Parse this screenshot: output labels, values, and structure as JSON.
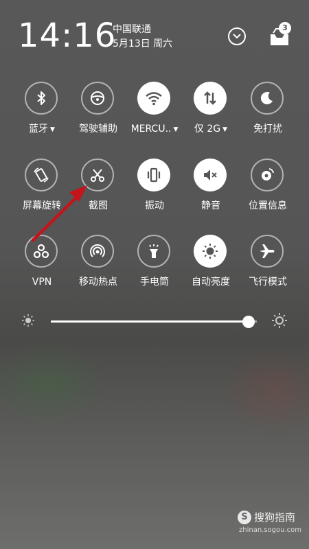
{
  "status": {
    "time": "14:16",
    "carrier": "中国联通",
    "date": "5月13日 周六",
    "notification_count": "3"
  },
  "tiles": [
    {
      "id": "bluetooth",
      "label": "蓝牙",
      "dropdown": true,
      "active": false,
      "icon": "bluetooth-icon"
    },
    {
      "id": "driving",
      "label": "驾驶辅助",
      "dropdown": false,
      "active": false,
      "icon": "steering-wheel-icon"
    },
    {
      "id": "wifi",
      "label": "MERCU..",
      "dropdown": true,
      "active": true,
      "icon": "wifi-icon"
    },
    {
      "id": "mobile-data",
      "label": "仅 2G",
      "dropdown": true,
      "active": true,
      "icon": "data-arrows-icon"
    },
    {
      "id": "dnd",
      "label": "免打扰",
      "dropdown": false,
      "active": false,
      "icon": "moon-icon"
    },
    {
      "id": "rotation",
      "label": "屏幕旋转",
      "dropdown": false,
      "active": false,
      "icon": "rotate-icon"
    },
    {
      "id": "screenshot",
      "label": "截图",
      "dropdown": false,
      "active": false,
      "icon": "scissors-icon"
    },
    {
      "id": "vibrate",
      "label": "振动",
      "dropdown": false,
      "active": true,
      "icon": "vibrate-icon"
    },
    {
      "id": "mute",
      "label": "静音",
      "dropdown": false,
      "active": true,
      "icon": "mute-icon"
    },
    {
      "id": "location",
      "label": "位置信息",
      "dropdown": false,
      "active": false,
      "icon": "location-icon"
    },
    {
      "id": "vpn",
      "label": "VPN",
      "dropdown": false,
      "active": false,
      "icon": "vpn-icon"
    },
    {
      "id": "hotspot",
      "label": "移动热点",
      "dropdown": false,
      "active": false,
      "icon": "hotspot-icon"
    },
    {
      "id": "flashlight",
      "label": "手电筒",
      "dropdown": false,
      "active": false,
      "icon": "flashlight-icon"
    },
    {
      "id": "auto-brightness",
      "label": "自动亮度",
      "dropdown": false,
      "active": true,
      "icon": "sun-icon"
    },
    {
      "id": "airplane",
      "label": "飞行模式",
      "dropdown": false,
      "active": false,
      "icon": "airplane-icon"
    }
  ],
  "brightness": {
    "level": 0.96
  },
  "colors": {
    "annotation_arrow": "#c4141c",
    "active_tile": "#ffffff",
    "icon_dark": "#555555"
  },
  "watermark": {
    "logo": "S",
    "text": "搜狗指南",
    "url": "zhinan.sogou.com"
  }
}
